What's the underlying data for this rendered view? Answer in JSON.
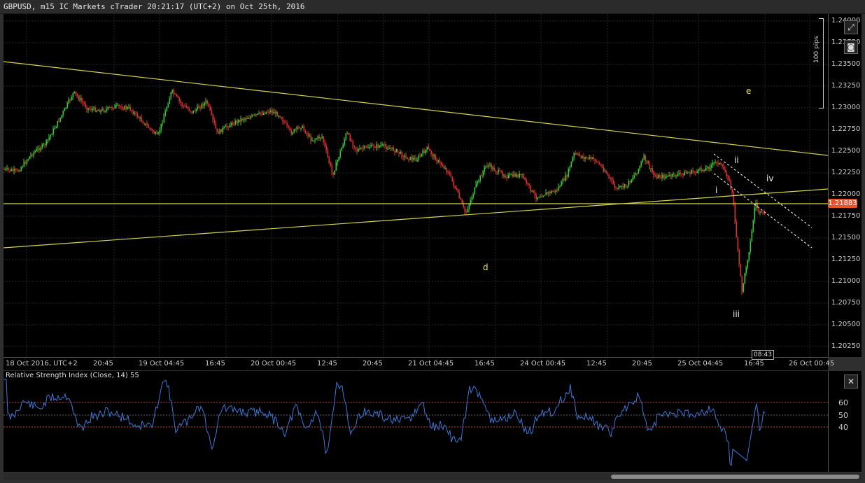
{
  "window": {
    "title": "GBPUSD, m15 IC Markets cTrader 20:21:17 (UTC+2) on Oct 25th, 2016"
  },
  "price_axis": {
    "labels": [
      "1.24000",
      "1.23750",
      "1.23500",
      "1.23250",
      "1.23000",
      "1.22750",
      "1.22500",
      "1.22250",
      "1.22000",
      "1.21750",
      "1.21500",
      "1.21250",
      "1.21000",
      "1.20750",
      "1.20500",
      "1.20250"
    ],
    "current_price": "1.21883",
    "pips_label": "100 pips"
  },
  "time_axis": {
    "labels": [
      "18 Oct 2016, UTC+2",
      "20:45",
      "19 Oct 04:45",
      "16:45",
      "20 Oct 00:45",
      "12:45",
      "20:45",
      "21 Oct 04:45",
      "16:45",
      "24 Oct 00:45",
      "12:45",
      "20:45",
      "25 Oct 04:45",
      "16:45",
      "26 Oct 00:45"
    ],
    "current_time": "08:43"
  },
  "wave_labels": {
    "e": "e",
    "d": "d",
    "i": "i",
    "ii": "ii",
    "iii": "iii",
    "iv": "iv"
  },
  "rsi": {
    "title": "Relative Strength Index (Close, 14) 55",
    "levels": [
      "60",
      "50",
      "40"
    ]
  },
  "icons": {
    "expand": "expand-icon",
    "camera": "camera-icon",
    "close": "close-icon"
  },
  "colors": {
    "bull": "#33cc33",
    "bear": "#e03030",
    "trendline": "#d4d44a",
    "rsi_line": "#3b78d8",
    "rsi_levels": "#e03030",
    "price_tag": "#e8532a"
  }
}
